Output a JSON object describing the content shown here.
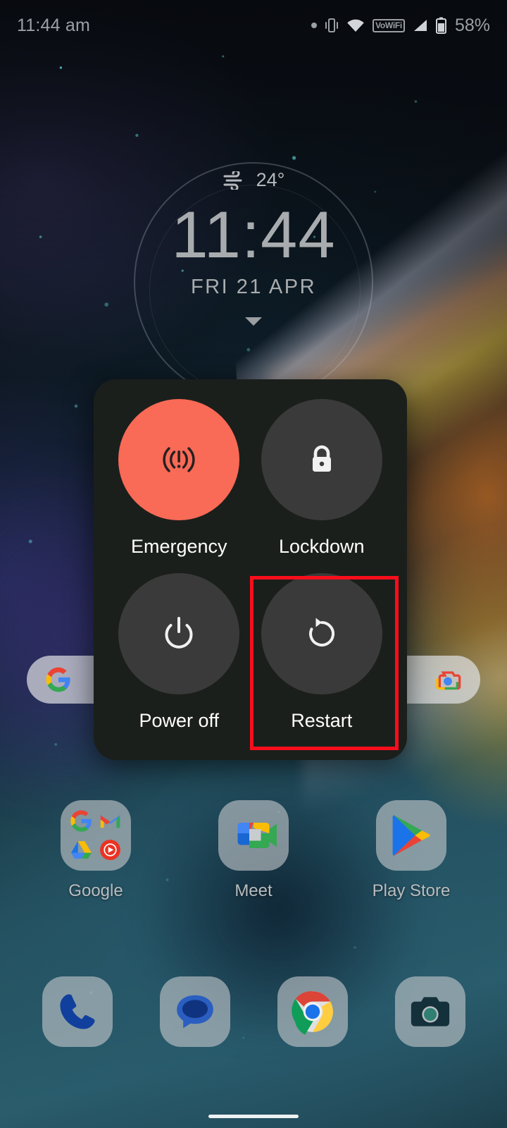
{
  "status_bar": {
    "time": "11:44 am",
    "battery_percent": "58%",
    "vowifi_label": "VoWiFi",
    "icons": [
      "notification-dot",
      "vibrate-icon",
      "wifi-icon",
      "vowifi-badge",
      "signal-icon",
      "battery-icon"
    ]
  },
  "clock_widget": {
    "temperature": "24°",
    "weather_icon": "windy-icon",
    "time": "11:44",
    "date": "FRI 21 APR",
    "expand_icon": "chevron-down-icon"
  },
  "search_widget": {
    "logo_icon": "google-g-icon",
    "lens_icon": "google-lens-icon"
  },
  "power_dialog": {
    "options": [
      {
        "label": "Emergency",
        "icon": "emergency-broadcast-icon",
        "accent": "#f96a57",
        "highlighted": false
      },
      {
        "label": "Lockdown",
        "icon": "lock-icon",
        "accent": "#3a3a3a",
        "highlighted": false
      },
      {
        "label": "Power off",
        "icon": "power-icon",
        "accent": "#3a3a3a",
        "highlighted": false
      },
      {
        "label": "Restart",
        "icon": "restart-icon",
        "accent": "#3a3a3a",
        "highlighted": true
      }
    ],
    "background_color": "#1b1f1b",
    "highlight_color": "#fb0d1b"
  },
  "home_screen": {
    "app_row": [
      {
        "label": "Google",
        "icon": "google-folder-icon"
      },
      {
        "label": "Meet",
        "icon": "google-meet-icon"
      },
      {
        "label": "Play Store",
        "icon": "google-play-store-icon"
      }
    ],
    "dock": [
      {
        "label": "Phone",
        "icon": "phone-icon"
      },
      {
        "label": "Messages",
        "icon": "messages-icon"
      },
      {
        "label": "Chrome",
        "icon": "chrome-icon"
      },
      {
        "label": "Camera",
        "icon": "camera-icon"
      }
    ]
  },
  "nav": {
    "home_indicator": "home-gesture-bar"
  }
}
